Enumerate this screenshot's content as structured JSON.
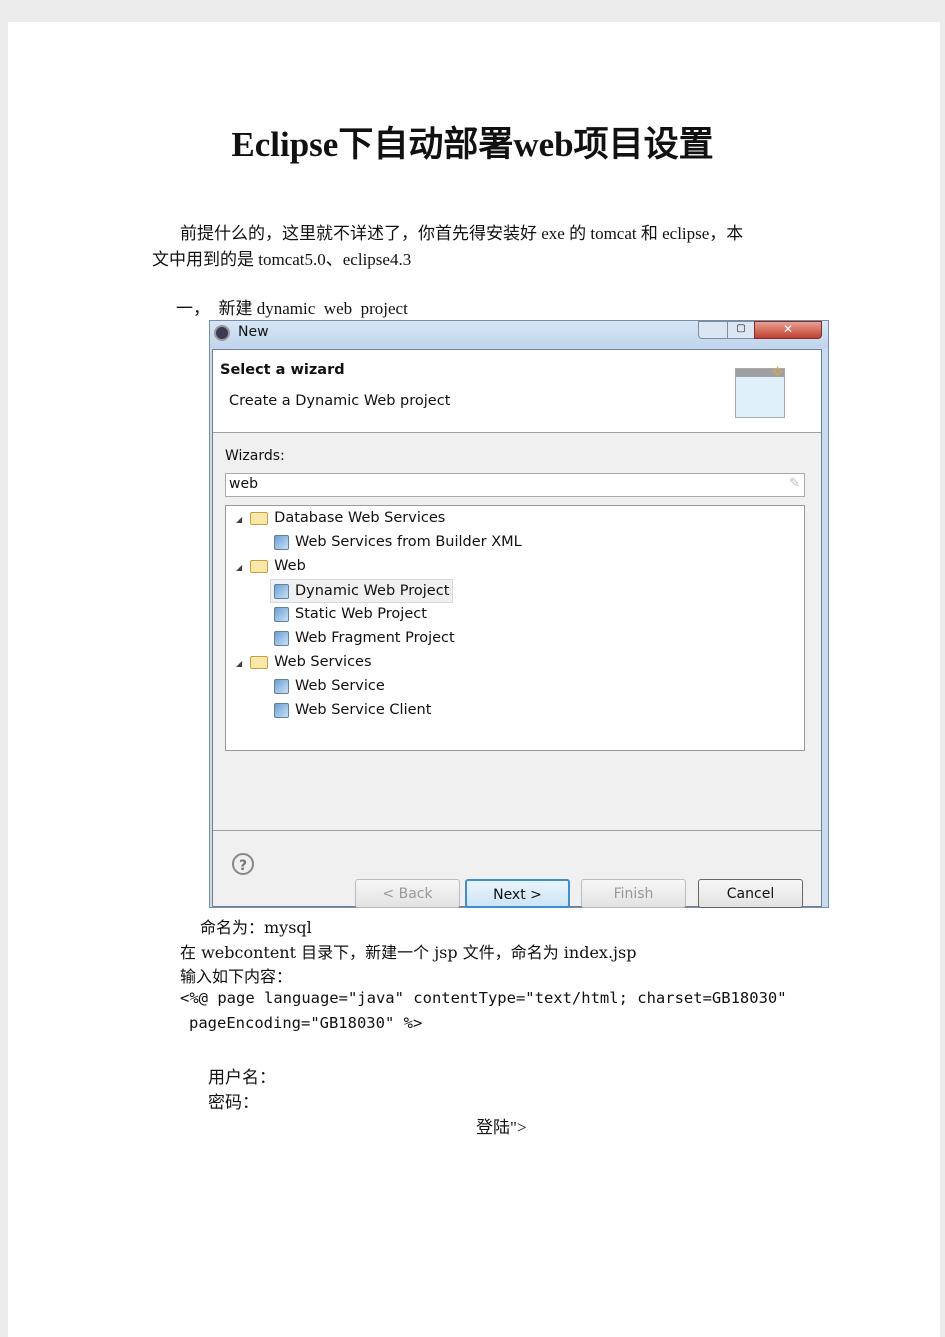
{
  "title": "Eclipse下自动部署web项目设置",
  "intro_line1": "前提什么的，这里就不详述了，你首先得安装好 exe 的 tomcat 和 eclipse，本",
  "intro_line2": "文中用到的是 tomcat5.0、eclipse4.3",
  "step1": "一，  新建 dynamic  web  project",
  "dialog": {
    "window_title": "New",
    "header_title": "Select a wizard",
    "header_desc": "Create a Dynamic Web project",
    "wizards_label": "Wizards:",
    "filter_value": "web",
    "tree": [
      {
        "label": "Database Web Services",
        "level": 0,
        "type": "folder",
        "expanded": true
      },
      {
        "label": "Web Services from Builder XML",
        "level": 1,
        "type": "item"
      },
      {
        "label": "Web",
        "level": 0,
        "type": "folder",
        "expanded": true
      },
      {
        "label": "Dynamic Web Project",
        "level": 1,
        "type": "item",
        "selected": true
      },
      {
        "label": "Static Web Project",
        "level": 1,
        "type": "item"
      },
      {
        "label": "Web Fragment Project",
        "level": 1,
        "type": "item"
      },
      {
        "label": "Web Services",
        "level": 0,
        "type": "folder",
        "expanded": true
      },
      {
        "label": "Web Service",
        "level": 1,
        "type": "item"
      },
      {
        "label": "Web Service Client",
        "level": 1,
        "type": "item"
      }
    ],
    "buttons": {
      "back": "< Back",
      "next": "Next >",
      "finish": "Finish",
      "cancel": "Cancel"
    }
  },
  "line_name": "命名为：mysql",
  "line_jsp": "在 webcontent 目录下，新建一个 jsp 文件，命名为 index.jsp",
  "line_input": "输入如下内容：",
  "code1": "<%@ page language=\"java\" contentType=\"text/html; charset=GB18030\"",
  "code2": "pageEncoding=\"GB18030\" %>",
  "username": "用户名：",
  "password": "密码：",
  "login": "登陆\">"
}
